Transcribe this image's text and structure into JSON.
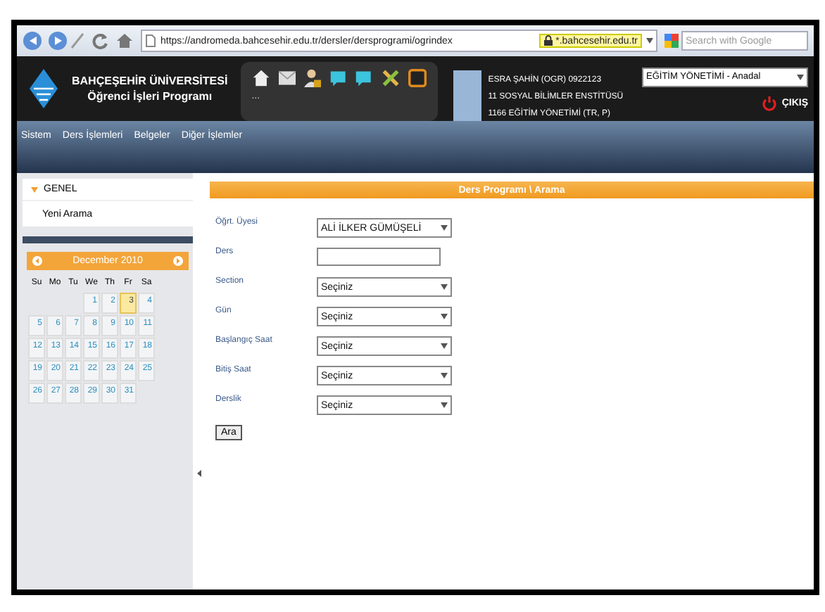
{
  "browser": {
    "url": "https://andromeda.bahcesehir.edu.tr/dersler/dersprogrami/ogrindex",
    "site_badge": "*.bahcesehir.edu.tr",
    "search_placeholder": "Search with Google"
  },
  "header": {
    "university": "BAHÇEŞEHİR ÜNİVERSİTESİ",
    "program": "Öğrenci İşleri Programı",
    "toolbar_more": "...",
    "user_lines": [
      "ESRA ŞAHİN (OGR) 0922123",
      "11 SOSYAL BİLİMLER ENSTİTÜSÜ",
      "1166 EĞİTİM YÖNETİMİ (TR, P)"
    ],
    "program_select": "EĞİTİM YÖNETİMİ - Anadal",
    "logout": "ÇIKIŞ"
  },
  "menu": [
    "Sistem",
    "Ders İşlemleri",
    "Belgeler",
    "Diğer İşlemler"
  ],
  "sidebar": {
    "section": {
      "label": "GENEL",
      "expanded": true,
      "items": [
        "Yeni Arama"
      ]
    }
  },
  "calendar": {
    "title": "December 2010",
    "weekdays": [
      "Su",
      "Mo",
      "Tu",
      "We",
      "Th",
      "Fr",
      "Sa"
    ],
    "weeks": [
      [
        {
          "kind": "blank"
        },
        {
          "kind": "blank"
        },
        {
          "kind": "blank"
        },
        {
          "day": "1",
          "selected": false
        },
        {
          "day": "2",
          "selected": false
        },
        {
          "day": "3",
          "selected": true
        },
        {
          "day": "4",
          "selected": false
        }
      ],
      [
        {
          "day": "5",
          "selected": false
        },
        {
          "day": "6",
          "selected": false
        },
        {
          "day": "7",
          "selected": false
        },
        {
          "day": "8",
          "selected": false
        },
        {
          "day": "9",
          "selected": false
        },
        {
          "day": "10",
          "selected": false
        },
        {
          "day": "11",
          "selected": false
        }
      ],
      [
        {
          "day": "12",
          "selected": false
        },
        {
          "day": "13",
          "selected": false
        },
        {
          "day": "14",
          "selected": false
        },
        {
          "day": "15",
          "selected": false
        },
        {
          "day": "16",
          "selected": false
        },
        {
          "day": "17",
          "selected": false
        },
        {
          "day": "18",
          "selected": false
        }
      ],
      [
        {
          "day": "19",
          "selected": false
        },
        {
          "day": "20",
          "selected": false
        },
        {
          "day": "21",
          "selected": false
        },
        {
          "day": "22",
          "selected": false
        },
        {
          "day": "23",
          "selected": false
        },
        {
          "day": "24",
          "selected": false
        },
        {
          "day": "25",
          "selected": false
        }
      ],
      [
        {
          "day": "26",
          "selected": false
        },
        {
          "day": "27",
          "selected": false
        },
        {
          "day": "28",
          "selected": false
        },
        {
          "day": "29",
          "selected": false
        },
        {
          "day": "30",
          "selected": false
        },
        {
          "day": "31",
          "selected": false
        },
        {
          "kind": "blank"
        }
      ]
    ]
  },
  "panel": {
    "title": "Ders Programı \\ Arama",
    "fields": [
      {
        "kind": "select",
        "label": "Öğrt. Üyesi",
        "value": "ALİ İLKER GÜMÜŞELİ"
      },
      {
        "kind": "text",
        "label": "Ders"
      },
      {
        "kind": "select",
        "label": "Section",
        "value": "Seçiniz"
      },
      {
        "kind": "select",
        "label": "Gün",
        "value": "Seçiniz"
      },
      {
        "kind": "select",
        "label": "Başlangıç Saat",
        "value": "Seçiniz"
      },
      {
        "kind": "select",
        "label": "Bitiş Saat",
        "value": "Seçiniz"
      },
      {
        "kind": "select",
        "label": "Derslik",
        "value": "Seçiniz"
      }
    ],
    "button": "Ara"
  }
}
